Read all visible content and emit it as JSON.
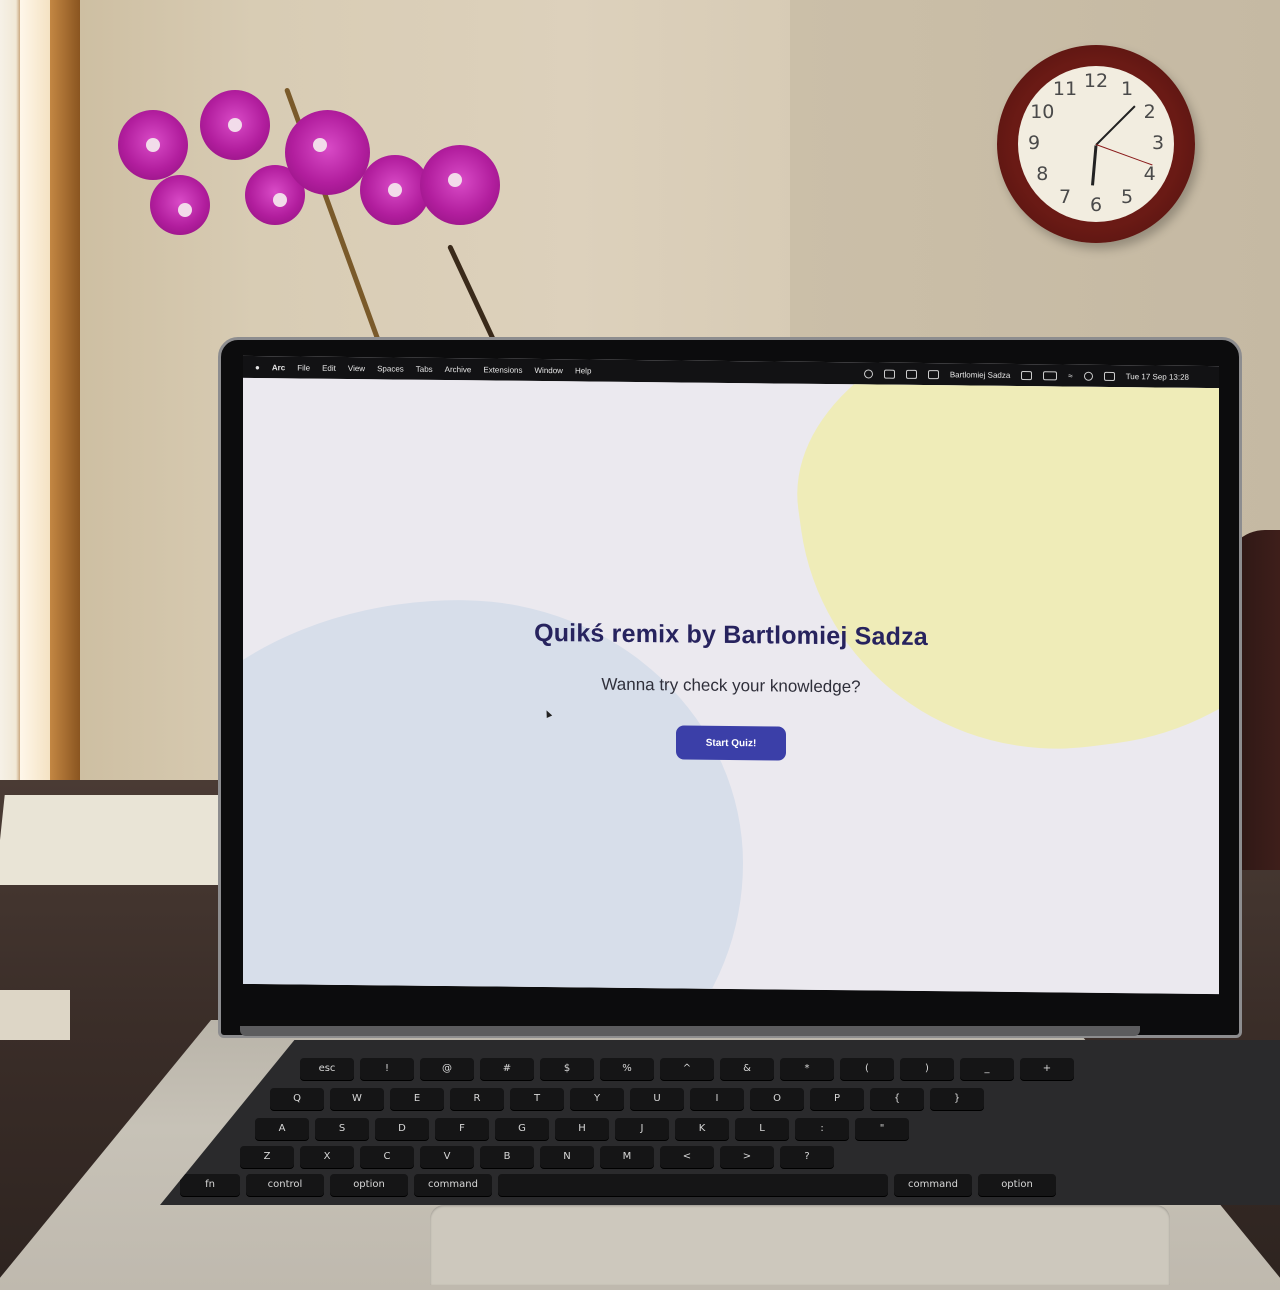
{
  "menubar": {
    "app_name": "Arc",
    "menus": [
      "File",
      "Edit",
      "View",
      "Spaces",
      "Tabs",
      "Archive",
      "Extensions",
      "Window",
      "Help"
    ],
    "user_name": "Bartlomiej Sadza",
    "datetime": "Tue 17 Sep  13:28"
  },
  "page": {
    "title": "Quikś remix by Bartlomiej Sadza",
    "subtitle": "Wanna try check your knowledge?",
    "start_button_label": "Start Quiz!"
  },
  "colors": {
    "title": "#27235e",
    "button": "#3b3fa8",
    "blob_yellow": "#efecb8",
    "blob_blue": "#d7deea",
    "page_bg": "#ebe9ef"
  },
  "clock": {
    "numerals": [
      "12",
      "1",
      "2",
      "3",
      "4",
      "5",
      "6",
      "7",
      "8",
      "9",
      "10",
      "11"
    ]
  },
  "keyboard": {
    "row1": [
      "esc",
      "!",
      "@",
      "#",
      "$",
      "%",
      "^",
      "&",
      "*",
      "(",
      ")",
      "_",
      "+"
    ],
    "row2": [
      "Q",
      "W",
      "E",
      "R",
      "T",
      "Y",
      "U",
      "I",
      "O",
      "P",
      "{",
      "}"
    ],
    "row3": [
      "A",
      "S",
      "D",
      "F",
      "G",
      "H",
      "J",
      "K",
      "L",
      ":",
      "\""
    ],
    "row4": [
      "Z",
      "X",
      "C",
      "V",
      "B",
      "N",
      "M",
      "<",
      ">",
      "?"
    ],
    "row5": [
      "fn",
      "control",
      "option",
      "command",
      "",
      "command",
      "option"
    ]
  }
}
